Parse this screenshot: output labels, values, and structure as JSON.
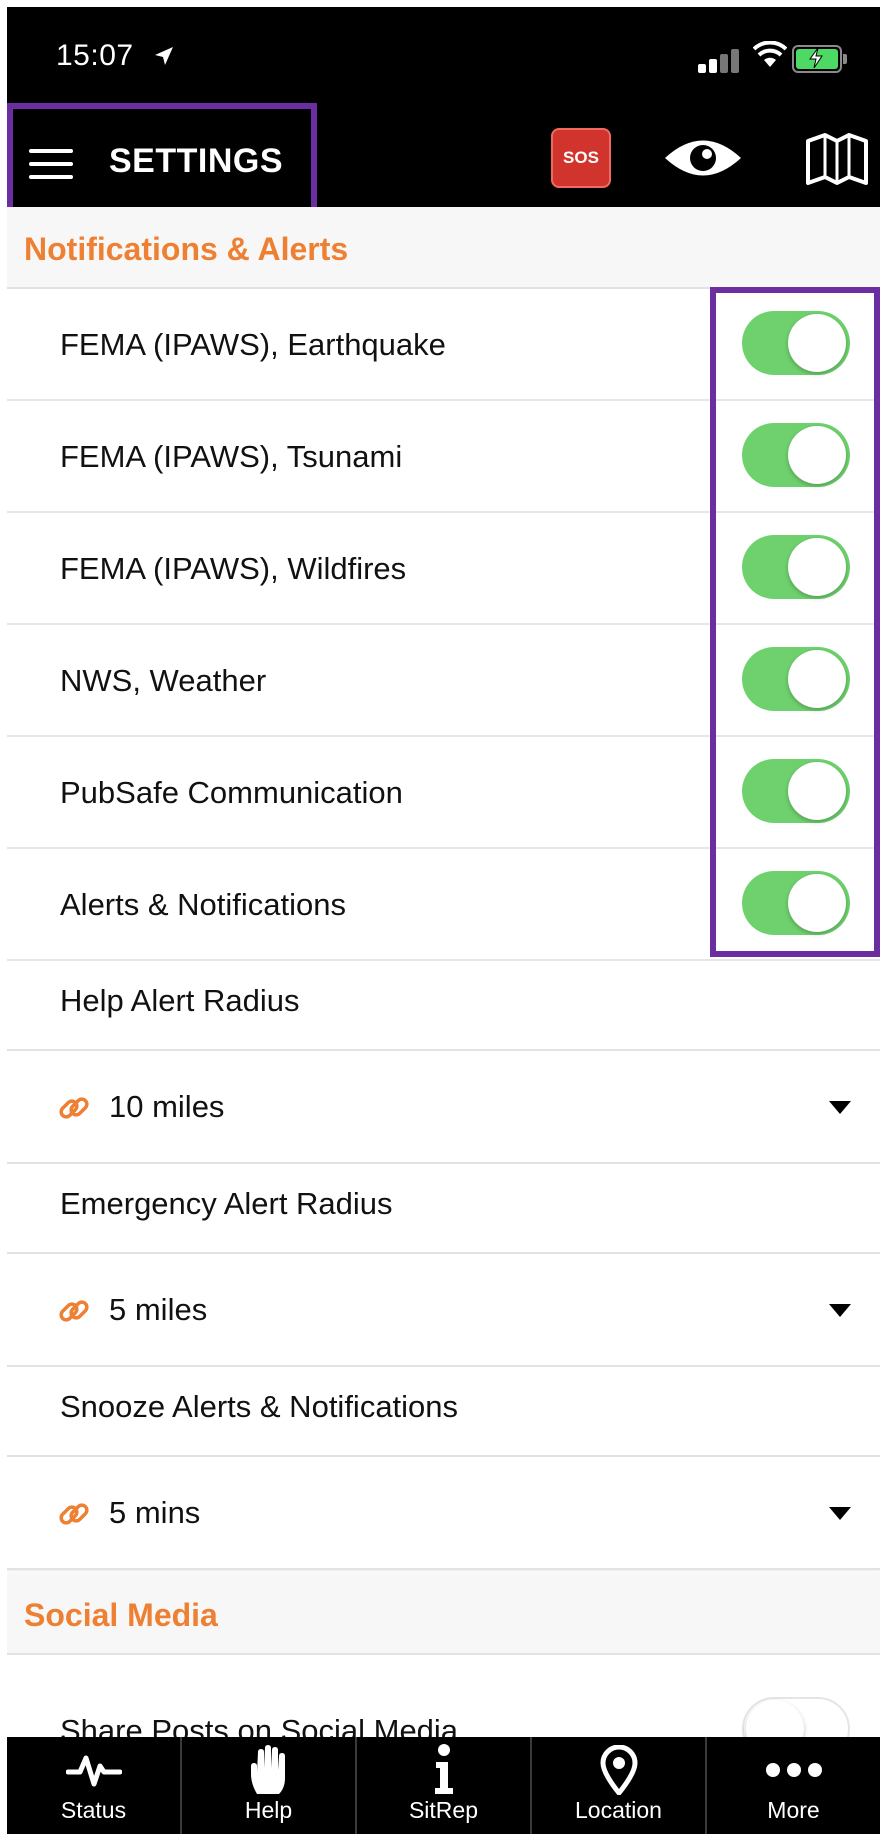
{
  "status_bar": {
    "time": "15:07"
  },
  "nav": {
    "title": "SETTINGS",
    "sos_label": "SOS"
  },
  "colors": {
    "accent": "#ee8033",
    "toggle_on": "#6ed16d",
    "highlight": "#6a2ea0",
    "sos": "#d0342c"
  },
  "sections": {
    "notifications": {
      "header": "Notifications & Alerts",
      "toggles": [
        {
          "label": "FEMA (IPAWS), Earthquake",
          "on": true
        },
        {
          "label": "FEMA (IPAWS), Tsunami",
          "on": true
        },
        {
          "label": "FEMA (IPAWS), Wildfires",
          "on": true
        },
        {
          "label": "NWS, Weather",
          "on": true
        },
        {
          "label": "PubSafe Communication",
          "on": true
        },
        {
          "label": "Alerts & Notifications",
          "on": true
        }
      ],
      "help_radius": {
        "label": "Help Alert Radius",
        "value": "10 miles"
      },
      "emergency_radius": {
        "label": "Emergency Alert Radius",
        "value": "5 miles"
      },
      "snooze": {
        "label": "Snooze Alerts & Notifications",
        "value": "5 mins"
      }
    },
    "social": {
      "header": "Social Media",
      "share": {
        "label": "Share Posts on Social Media",
        "on": false
      }
    }
  },
  "tabs": [
    {
      "label": "Status",
      "icon": "pulse-icon"
    },
    {
      "label": "Help",
      "icon": "hand-icon"
    },
    {
      "label": "SitRep",
      "icon": "info-icon"
    },
    {
      "label": "Location",
      "icon": "location-pin-icon"
    },
    {
      "label": "More",
      "icon": "more-dots-icon"
    }
  ]
}
